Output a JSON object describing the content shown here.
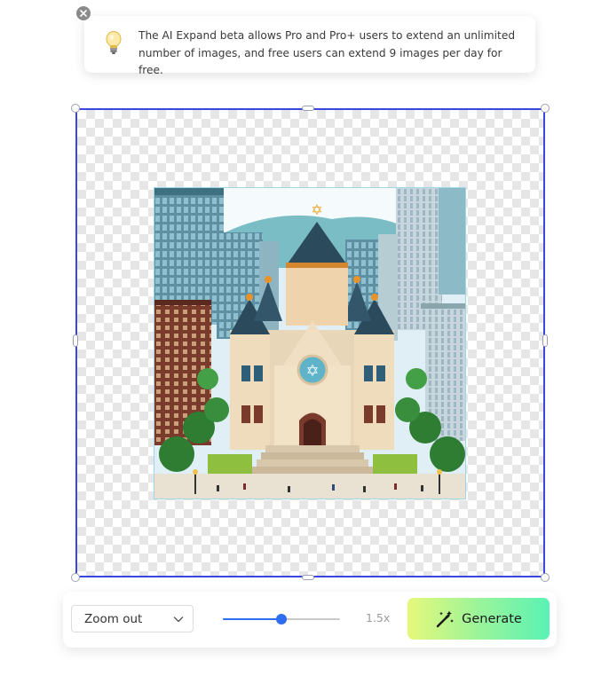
{
  "notice": {
    "message": "The AI Expand beta allows Pro and Pro+ users to extend an unlimited number of images, and free users can extend 9 images per day for free.",
    "icon": "lightbulb-icon",
    "close_icon": "close-icon"
  },
  "canvas": {
    "frame_color": "#3b46e0",
    "background": "transparent-checkerboard",
    "image_subject": "pixel-art cathedral"
  },
  "toolbar": {
    "zoom_select": {
      "selected": "Zoom out",
      "icon": "chevron-down-icon"
    },
    "zoom_slider": {
      "fraction": 0.5
    },
    "zoom_value": "1.5x",
    "generate": {
      "label": "Generate",
      "icon": "magic-wand-icon"
    }
  },
  "colors": {
    "accent": "#2f6df0",
    "generate_gradient_start": "#e6f87a",
    "generate_gradient_end": "#5af2b4"
  }
}
